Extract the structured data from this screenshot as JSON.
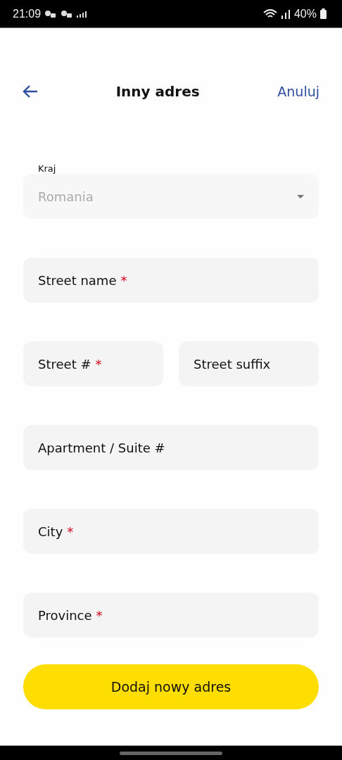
{
  "status_bar": {
    "time": "21:09",
    "battery": "40%"
  },
  "header": {
    "title": "Inny adres",
    "cancel": "Anuluj"
  },
  "country": {
    "label": "Kraj",
    "value": "Romania"
  },
  "fields": [
    {
      "kind": "wide",
      "placeholder": "Street name",
      "required_mark": "*"
    },
    {
      "kind": "narrow",
      "placeholder": "Street #",
      "required_mark": "*"
    },
    {
      "kind": "narrow",
      "placeholder": "Street suffix"
    },
    {
      "kind": "wide",
      "placeholder": "Apartment / Suite #"
    },
    {
      "kind": "wide",
      "placeholder": "City",
      "required_mark": "*"
    },
    {
      "kind": "wide",
      "placeholder": "Province",
      "required_mark": "*"
    }
  ],
  "submit": "Dodaj nowy adres"
}
